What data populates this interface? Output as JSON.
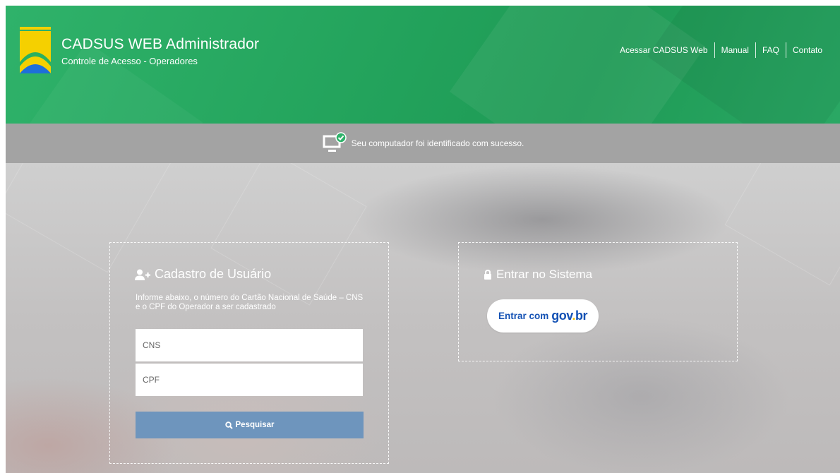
{
  "header": {
    "title": "CADSUS WEB Administrador",
    "subtitle": "Controle de Acesso - Operadores",
    "nav": [
      "Acessar CADSUS Web",
      "Manual",
      "FAQ",
      "Contato"
    ]
  },
  "notice": {
    "text": "Seu computador foi identificado com sucesso."
  },
  "register": {
    "title": "Cadastro de Usuário",
    "instructions": "Informe abaixo, o número do Cartão Nacional de Saúde – CNS e o CPF do Operador a ser cadastrado",
    "cns_placeholder": "CNS",
    "cpf_placeholder": "CPF",
    "search_label": "Pesquisar"
  },
  "login": {
    "title": "Entrar no Sistema",
    "govbr_label": "Entrar com",
    "govbr_brand_a": "gov",
    "govbr_brand_dot": ".",
    "govbr_brand_b": "br"
  },
  "colors": {
    "header_green": "#23a35c",
    "notice_gray": "#a3a3a3",
    "search_button": "#6e95bd",
    "govbr_blue": "#1351b4",
    "logo_yellow": "#f5d000",
    "logo_green": "#2bb05f",
    "logo_blue": "#1e6fd9"
  },
  "icons": {
    "logo": "sus-logo-icon",
    "notice": "computer-check-icon",
    "register": "user-add-icon",
    "login": "lock-icon",
    "search": "search-icon"
  }
}
